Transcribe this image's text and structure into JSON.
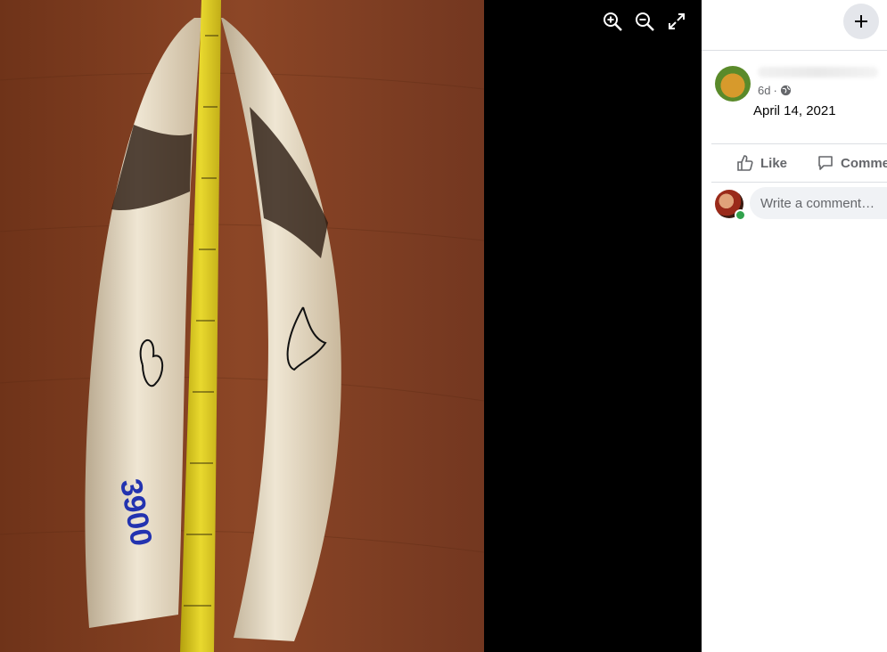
{
  "viewer": {
    "photo_alt": "Two ivory tusks beside a measuring tape on a wooden table",
    "tusk_mark": "3900",
    "controls": [
      {
        "name": "zoom-in-icon"
      },
      {
        "name": "zoom-out-icon"
      },
      {
        "name": "fullscreen-icon"
      }
    ]
  },
  "panel": {
    "create_icon": "plus-icon",
    "post": {
      "time": "6d",
      "separator": "·",
      "privacy_icon": "globe-icon",
      "date": "April 14, 2021"
    },
    "actions": {
      "like_label": "Like",
      "comment_label": "Comme"
    },
    "comment_box": {
      "placeholder": "Write a comment…"
    }
  },
  "colors": {
    "panel_bg": "#ffffff",
    "viewer_bg": "#000000",
    "muted_text": "#65676b",
    "online": "#31a24c"
  }
}
